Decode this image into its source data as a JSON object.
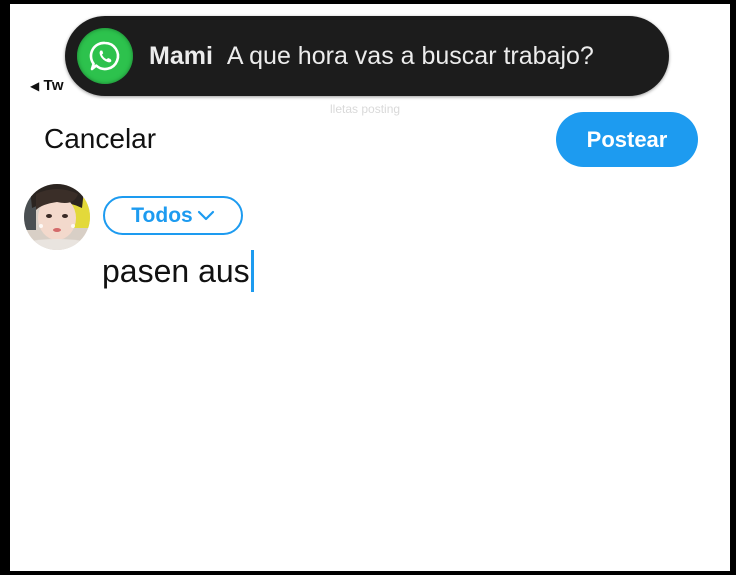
{
  "status_bar": {
    "back_label": "Tw"
  },
  "notification": {
    "app_icon": "whatsapp-icon",
    "sender": "Mami",
    "message": "A que hora vas a buscar trabajo?"
  },
  "header": {
    "cancel_label": "Cancelar",
    "post_label": "Postear",
    "faint_hint": "lletas posting"
  },
  "composer": {
    "audience_label": "Todos",
    "text": "pasen aus"
  },
  "colors": {
    "accent": "#1d9bf0",
    "notification_bg": "#1c1c1c",
    "whatsapp_green": "#2dc24d"
  }
}
